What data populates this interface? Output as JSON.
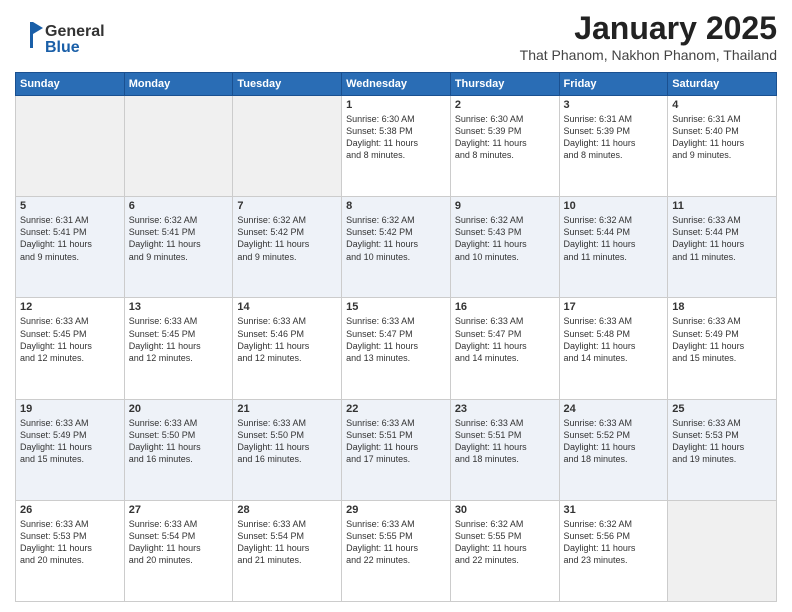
{
  "header": {
    "logo_general": "General",
    "logo_blue": "Blue",
    "month_year": "January 2025",
    "location": "That Phanom, Nakhon Phanom, Thailand"
  },
  "weekdays": [
    "Sunday",
    "Monday",
    "Tuesday",
    "Wednesday",
    "Thursday",
    "Friday",
    "Saturday"
  ],
  "weeks": [
    [
      {
        "day": "",
        "info": ""
      },
      {
        "day": "",
        "info": ""
      },
      {
        "day": "",
        "info": ""
      },
      {
        "day": "1",
        "info": "Sunrise: 6:30 AM\nSunset: 5:38 PM\nDaylight: 11 hours\nand 8 minutes."
      },
      {
        "day": "2",
        "info": "Sunrise: 6:30 AM\nSunset: 5:39 PM\nDaylight: 11 hours\nand 8 minutes."
      },
      {
        "day": "3",
        "info": "Sunrise: 6:31 AM\nSunset: 5:39 PM\nDaylight: 11 hours\nand 8 minutes."
      },
      {
        "day": "4",
        "info": "Sunrise: 6:31 AM\nSunset: 5:40 PM\nDaylight: 11 hours\nand 9 minutes."
      }
    ],
    [
      {
        "day": "5",
        "info": "Sunrise: 6:31 AM\nSunset: 5:41 PM\nDaylight: 11 hours\nand 9 minutes."
      },
      {
        "day": "6",
        "info": "Sunrise: 6:32 AM\nSunset: 5:41 PM\nDaylight: 11 hours\nand 9 minutes."
      },
      {
        "day": "7",
        "info": "Sunrise: 6:32 AM\nSunset: 5:42 PM\nDaylight: 11 hours\nand 9 minutes."
      },
      {
        "day": "8",
        "info": "Sunrise: 6:32 AM\nSunset: 5:42 PM\nDaylight: 11 hours\nand 10 minutes."
      },
      {
        "day": "9",
        "info": "Sunrise: 6:32 AM\nSunset: 5:43 PM\nDaylight: 11 hours\nand 10 minutes."
      },
      {
        "day": "10",
        "info": "Sunrise: 6:32 AM\nSunset: 5:44 PM\nDaylight: 11 hours\nand 11 minutes."
      },
      {
        "day": "11",
        "info": "Sunrise: 6:33 AM\nSunset: 5:44 PM\nDaylight: 11 hours\nand 11 minutes."
      }
    ],
    [
      {
        "day": "12",
        "info": "Sunrise: 6:33 AM\nSunset: 5:45 PM\nDaylight: 11 hours\nand 12 minutes."
      },
      {
        "day": "13",
        "info": "Sunrise: 6:33 AM\nSunset: 5:45 PM\nDaylight: 11 hours\nand 12 minutes."
      },
      {
        "day": "14",
        "info": "Sunrise: 6:33 AM\nSunset: 5:46 PM\nDaylight: 11 hours\nand 12 minutes."
      },
      {
        "day": "15",
        "info": "Sunrise: 6:33 AM\nSunset: 5:47 PM\nDaylight: 11 hours\nand 13 minutes."
      },
      {
        "day": "16",
        "info": "Sunrise: 6:33 AM\nSunset: 5:47 PM\nDaylight: 11 hours\nand 14 minutes."
      },
      {
        "day": "17",
        "info": "Sunrise: 6:33 AM\nSunset: 5:48 PM\nDaylight: 11 hours\nand 14 minutes."
      },
      {
        "day": "18",
        "info": "Sunrise: 6:33 AM\nSunset: 5:49 PM\nDaylight: 11 hours\nand 15 minutes."
      }
    ],
    [
      {
        "day": "19",
        "info": "Sunrise: 6:33 AM\nSunset: 5:49 PM\nDaylight: 11 hours\nand 15 minutes."
      },
      {
        "day": "20",
        "info": "Sunrise: 6:33 AM\nSunset: 5:50 PM\nDaylight: 11 hours\nand 16 minutes."
      },
      {
        "day": "21",
        "info": "Sunrise: 6:33 AM\nSunset: 5:50 PM\nDaylight: 11 hours\nand 16 minutes."
      },
      {
        "day": "22",
        "info": "Sunrise: 6:33 AM\nSunset: 5:51 PM\nDaylight: 11 hours\nand 17 minutes."
      },
      {
        "day": "23",
        "info": "Sunrise: 6:33 AM\nSunset: 5:51 PM\nDaylight: 11 hours\nand 18 minutes."
      },
      {
        "day": "24",
        "info": "Sunrise: 6:33 AM\nSunset: 5:52 PM\nDaylight: 11 hours\nand 18 minutes."
      },
      {
        "day": "25",
        "info": "Sunrise: 6:33 AM\nSunset: 5:53 PM\nDaylight: 11 hours\nand 19 minutes."
      }
    ],
    [
      {
        "day": "26",
        "info": "Sunrise: 6:33 AM\nSunset: 5:53 PM\nDaylight: 11 hours\nand 20 minutes."
      },
      {
        "day": "27",
        "info": "Sunrise: 6:33 AM\nSunset: 5:54 PM\nDaylight: 11 hours\nand 20 minutes."
      },
      {
        "day": "28",
        "info": "Sunrise: 6:33 AM\nSunset: 5:54 PM\nDaylight: 11 hours\nand 21 minutes."
      },
      {
        "day": "29",
        "info": "Sunrise: 6:33 AM\nSunset: 5:55 PM\nDaylight: 11 hours\nand 22 minutes."
      },
      {
        "day": "30",
        "info": "Sunrise: 6:32 AM\nSunset: 5:55 PM\nDaylight: 11 hours\nand 22 minutes."
      },
      {
        "day": "31",
        "info": "Sunrise: 6:32 AM\nSunset: 5:56 PM\nDaylight: 11 hours\nand 23 minutes."
      },
      {
        "day": "",
        "info": ""
      }
    ]
  ]
}
